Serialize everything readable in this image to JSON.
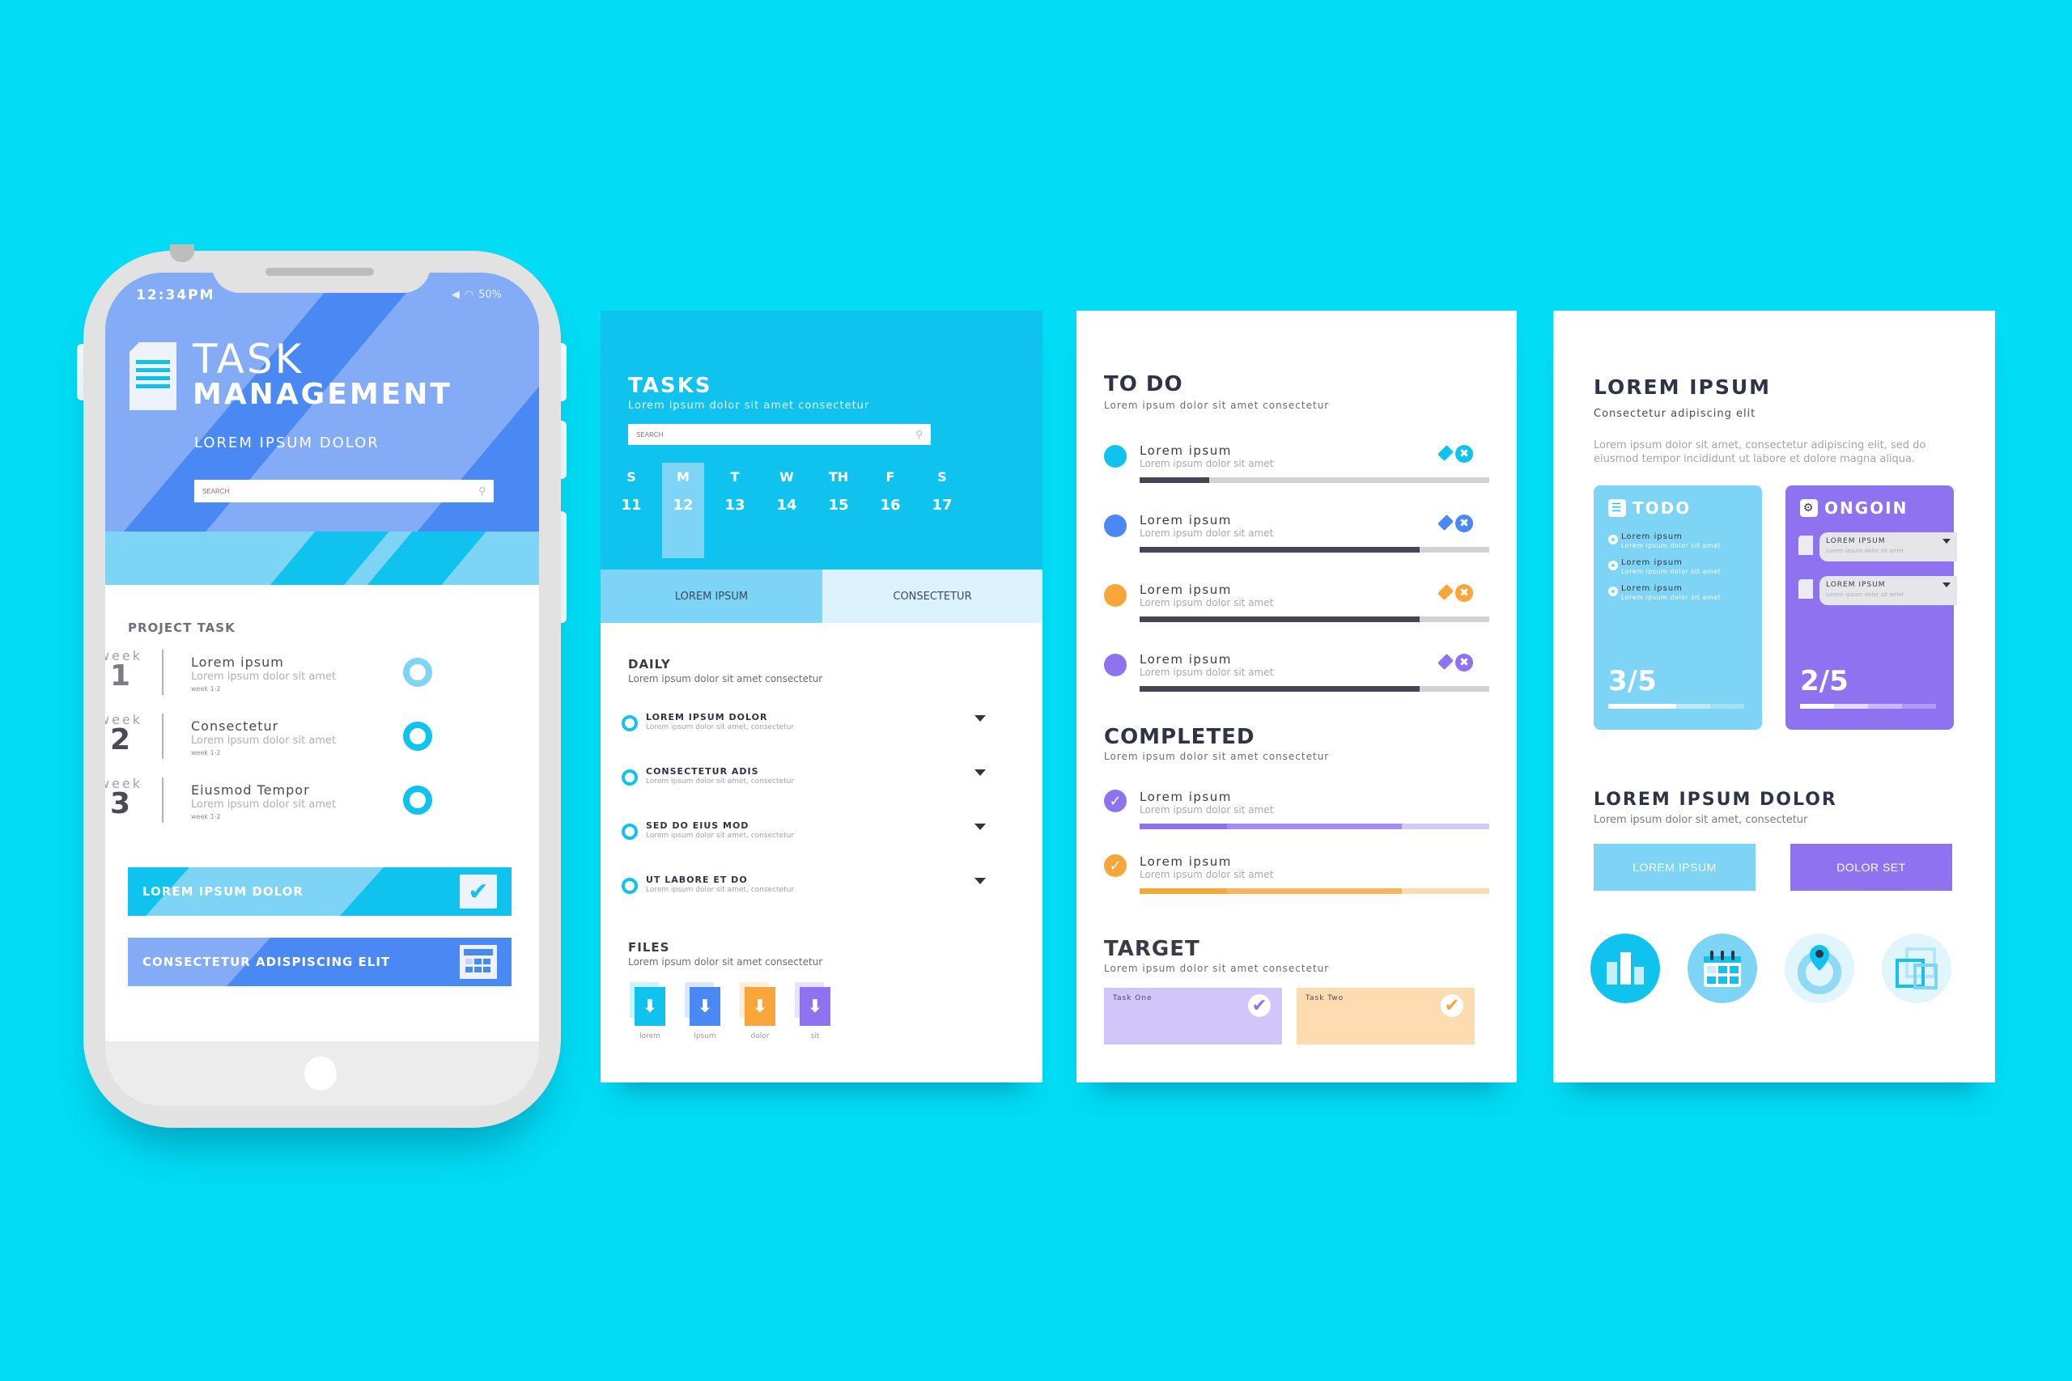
{
  "colors": {
    "background": "#02dcf5",
    "cyan": "#10c2ee",
    "light_cyan": "#7dd4f4",
    "blue": "#4a88f3",
    "orange": "#f8a63a",
    "purple": "#8e72f0",
    "dark": "#454556"
  },
  "phone": {
    "status": {
      "time": "12:34PM",
      "volume_icon": "speaker-icon",
      "wifi_icon": "wifi-icon",
      "battery": "50%"
    },
    "header": {
      "icon": "document-icon",
      "title_line1": "TASK",
      "title_line2": "MANAGEMENT",
      "subtitle": "LOREM IPSUM DOLOR",
      "search_placeholder": "SEARCH"
    },
    "project_task": {
      "label": "PROJECT TASK",
      "weeks": [
        {
          "week_word": "week",
          "number": "1",
          "title": "Lorem ipsum",
          "desc": "Lorem ipsum dolor sit amet",
          "sub": "week 1-2",
          "ring_color": "#7dd4f4"
        },
        {
          "week_word": "week",
          "number": "2",
          "title": "Consectetur",
          "desc": "Lorem ipsum dolor sit amet",
          "sub": "week 1-2",
          "ring_color": "#10c2ee"
        },
        {
          "week_word": "week",
          "number": "3",
          "title": "Eiusmod Tempor",
          "desc": "Lorem ipsum dolor sit amet",
          "sub": "week 1-2",
          "ring_color": "#10c2ee"
        }
      ]
    },
    "actions": [
      {
        "label": "LOREM IPSUM DOLOR",
        "icon": "checkbox-icon"
      },
      {
        "label": "CONSECTETUR ADISPISCING ELIT",
        "icon": "calendar-icon"
      }
    ]
  },
  "tasks_panel": {
    "title": "TASKS",
    "subtitle": "Lorem ipsum dolor sit amet consectetur",
    "search_placeholder": "SEARCH",
    "calendar": {
      "selected_index": 1,
      "days": [
        {
          "day": "S",
          "date": "11"
        },
        {
          "day": "M",
          "date": "12"
        },
        {
          "day": "T",
          "date": "13"
        },
        {
          "day": "W",
          "date": "14"
        },
        {
          "day": "TH",
          "date": "15"
        },
        {
          "day": "F",
          "date": "16"
        },
        {
          "day": "S",
          "date": "17"
        }
      ]
    },
    "tabs": [
      {
        "label": "LOREM IPSUM",
        "active": true
      },
      {
        "label": "CONSECTETUR",
        "active": false
      }
    ],
    "daily": {
      "title": "DAILY",
      "subtitle": "Lorem ipsum dolor sit amet consectetur",
      "items": [
        {
          "title": "LOREM IPSUM DOLOR",
          "desc": "Lorem ipsum dolor sit amet, consectetur"
        },
        {
          "title": "CONSECTETUR ADIS",
          "desc": "Lorem ipsum dolor sit amet, consectetur"
        },
        {
          "title": "SED DO EIUS MOD",
          "desc": "Lorem ipsum dolor sit amet, consectetur"
        },
        {
          "title": "UT LABORE ET DO",
          "desc": "Lorem ipsum dolor sit amet, consectetur"
        }
      ]
    },
    "files": {
      "title": "FILES",
      "subtitle": "Lorem ipsum dolor sit amet consectetur",
      "items": [
        {
          "label": "lorem",
          "color": "#10c2ee",
          "icon": "download-icon"
        },
        {
          "label": "ipsum",
          "color": "#4a88f3",
          "icon": "download-icon"
        },
        {
          "label": "dolor",
          "color": "#f8a63a",
          "icon": "download-icon"
        },
        {
          "label": "sit",
          "color": "#8e72f0",
          "icon": "download-icon"
        }
      ]
    }
  },
  "todo_panel": {
    "todo": {
      "title": "TO DO",
      "subtitle": "Lorem ipsum dolor sit amet consectetur",
      "items": [
        {
          "title": "Lorem ipsum",
          "desc": "Lorem ipsum dolor sit amet",
          "color": "#10c2ee",
          "progress": 0.2
        },
        {
          "title": "Lorem ipsum",
          "desc": "Lorem ipsum dolor sit amet",
          "color": "#4a88f3",
          "progress": 0.8
        },
        {
          "title": "Lorem ipsum",
          "desc": "Lorem ipsum dolor sit amet",
          "color": "#f8a63a",
          "progress": 0.8
        },
        {
          "title": "Lorem ipsum",
          "desc": "Lorem ipsum dolor sit amet",
          "color": "#8e72f0",
          "progress": 0.8
        }
      ]
    },
    "completed": {
      "title": "COMPLETED",
      "subtitle": "Lorem ipsum dolor sit amet consectetur",
      "items": [
        {
          "title": "Lorem ipsum",
          "desc": "Lorem ipsum dolor sit amet",
          "color": "#8e72f0",
          "segments": [
            "#8e72f0",
            "#a48cf3",
            "#a48cf3",
            "#d3c9f9"
          ]
        },
        {
          "title": "Lorem ipsum",
          "desc": "Lorem ipsum dolor sit amet",
          "color": "#f8a63a",
          "segments": [
            "#f8a63a",
            "#f9b55b",
            "#f9b55b",
            "#fcdcb2"
          ]
        }
      ]
    },
    "target": {
      "title": "TARGET",
      "subtitle": "Lorem ipsum dolor sit amet consectetur",
      "items": [
        {
          "label": "Task One",
          "bg": "#d0c6f9",
          "check_color": "#8e72f0"
        },
        {
          "label": "Task Two",
          "bg": "#fddcb2",
          "check_color": "#f8a63a"
        }
      ]
    }
  },
  "board_panel": {
    "title": "LOREM IPSUM",
    "subtitle": "Consectetur adipiscing elit",
    "paragraph": "Lorem ipsum dolor sit amet, consectetur adipiscing elit, sed do eiusmod tempor  incididunt ut labore et dolore magna aliqua.",
    "cards": {
      "todo": {
        "title": "TODO",
        "icon": "checklist-icon",
        "count": "3/5",
        "progress": 0.6,
        "items": [
          {
            "title": "Lorem ipsum",
            "desc": "Lorem ipsum dolor sit amet"
          },
          {
            "title": "Lorem ipsum",
            "desc": "Lorem ipsum dolor sit amet"
          },
          {
            "title": "Lorem ipsum",
            "desc": "Lorem ipsum dolor sit amet"
          }
        ]
      },
      "ongoing": {
        "title": "ONGOIN",
        "icon": "gear-icon",
        "count": "2/5",
        "progress": 0.4,
        "items": [
          {
            "title": "LOREM IPSUM",
            "desc": "Lorem ipsum dolor sit amet"
          },
          {
            "title": "LOREM IPSUM",
            "desc": "Lorem ipsum dolor sit amet"
          }
        ]
      }
    },
    "section2": {
      "title": "LOREM IPSUM DOLOR",
      "subtitle": "Lorem ipsum dolor sit amet, consectetur",
      "buttons": [
        {
          "label": "LOREM IPSUM",
          "color": "#7dd4f4"
        },
        {
          "label": "DOLOR SET",
          "color": "#8e72f0"
        }
      ]
    },
    "icons": [
      "bar-chart-icon",
      "calendar-icon",
      "location-pin-icon",
      "layers-icon"
    ]
  }
}
